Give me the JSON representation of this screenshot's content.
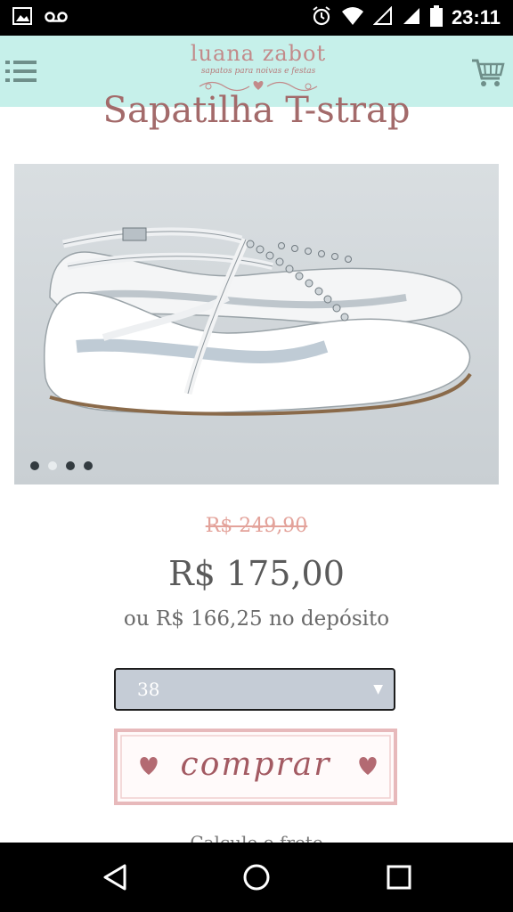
{
  "status_bar": {
    "time": "23:11",
    "icons": [
      "image-icon",
      "voicemail-icon",
      "alarm-icon",
      "wifi-icon",
      "signal-empty-icon",
      "signal-icon",
      "battery-icon"
    ]
  },
  "header": {
    "logo_text": "luana zabot",
    "logo_tagline": "sapatos para noivas e festas",
    "background": "#c6f0ea",
    "menu_icon": "hamburger-icon",
    "cart_icon": "shopping-cart-icon"
  },
  "product": {
    "title": "Sapatilha T-strap",
    "old_price": "R$ 249,90",
    "price": "R$ 175,00",
    "deposit_price": "ou R$ 166,25 no depósito",
    "size_selected": "38",
    "buy_label": "comprar",
    "gallery": {
      "slides": 4,
      "active": 1
    }
  },
  "footer_partial_text": "Calcule o frete",
  "colors": {
    "title": "#a36a6a",
    "old_price": "#e3a29a",
    "buy_text": "#a35a62",
    "buy_border": "#e7b9bb"
  }
}
